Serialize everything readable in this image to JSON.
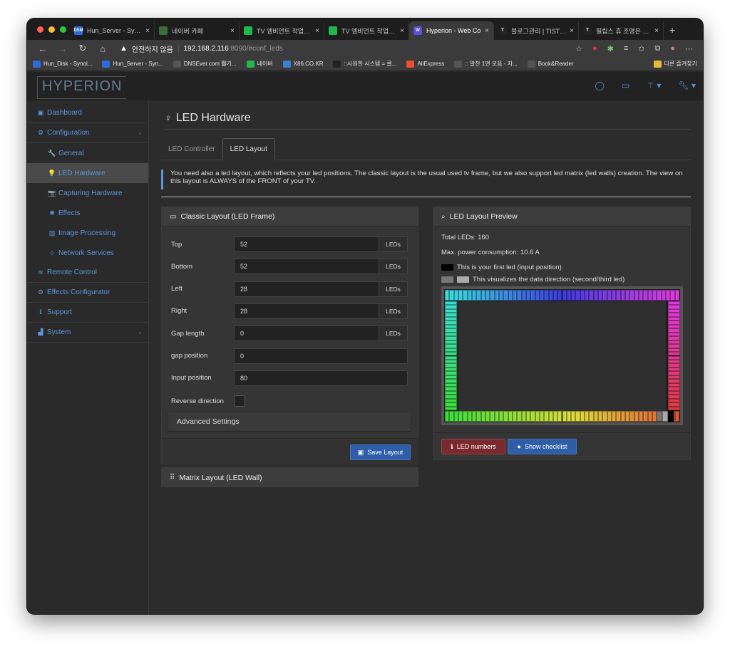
{
  "browser": {
    "tabs": [
      {
        "label": "Hun_Server - Synol",
        "icon_text": "DSM",
        "icon_color": "#2d6ad8",
        "active": false
      },
      {
        "label": "네이버 카페",
        "icon_text": "",
        "icon_color": "#3c6b3c",
        "active": false
      },
      {
        "label": "TV 엠비언트 작업기 1(",
        "icon_text": "",
        "icon_color": "#1fb84a",
        "active": false
      },
      {
        "label": "TV 엠비언트 작업기 1(",
        "icon_text": "",
        "icon_color": "#1fb84a",
        "active": false
      },
      {
        "label": "Hyperion - Web Co",
        "icon_text": "W",
        "icon_color": "#5a4fd8",
        "active": true
      },
      {
        "label": "블로그관리 | TISTOR",
        "icon_text": "T",
        "icon_color": "#222222",
        "active": false
      },
      {
        "label": "필립스 휴 조명은 가리",
        "icon_text": "T",
        "icon_color": "#222222",
        "active": false
      }
    ],
    "security_label": "안전하지 않음",
    "url_host": "192.168.2.116",
    "url_path": ":8090/#conf_leds",
    "bookmarks": [
      {
        "label": "Hun_Disk - Synol...",
        "color": "#2d6ad8"
      },
      {
        "label": "Hun_Server - Syn...",
        "color": "#2d6ad8"
      },
      {
        "label": "DNSEver.com 뭴기...",
        "color": "#555555"
      },
      {
        "label": "네이버",
        "color": "#1fb84a"
      },
      {
        "label": "X86.CO.KR",
        "color": "#3a7fd0"
      },
      {
        "label": "::시원한 시스템 = 쿨...",
        "color": "#222222"
      },
      {
        "label": "AliExpress",
        "color": "#e8502a"
      },
      {
        "label": ":: 알찬 1면 모음 - 자...",
        "color": "#555555"
      },
      {
        "label": "Book&Reader",
        "color": "#555555"
      }
    ],
    "other_bookmarks": "다른 즐겨찾기"
  },
  "app": {
    "logo": "HYPERION",
    "sidebar": [
      {
        "label": "Dashboard",
        "icon": "▣",
        "sub": false,
        "active": false,
        "caret": false,
        "name": "dashboard"
      },
      {
        "label": "Configuration",
        "icon": "⚙",
        "sub": false,
        "active": false,
        "caret": true,
        "name": "configuration"
      },
      {
        "label": "General",
        "icon": "🔧",
        "sub": true,
        "active": false,
        "caret": false,
        "name": "general"
      },
      {
        "label": "LED Hardware",
        "icon": "💡",
        "sub": true,
        "active": true,
        "caret": false,
        "name": "led-hardware"
      },
      {
        "label": "Capturing Hardware",
        "icon": "📷",
        "sub": true,
        "active": false,
        "caret": false,
        "name": "capturing-hardware"
      },
      {
        "label": "Effects",
        "icon": "✺",
        "sub": true,
        "active": false,
        "caret": false,
        "name": "effects"
      },
      {
        "label": "Image Processing",
        "icon": "▨",
        "sub": true,
        "active": false,
        "caret": false,
        "name": "image-processing"
      },
      {
        "label": "Network Services",
        "icon": "⊹",
        "sub": true,
        "active": false,
        "caret": false,
        "name": "network-services"
      },
      {
        "label": "Remote Control",
        "icon": "≋",
        "sub": false,
        "active": false,
        "caret": false,
        "name": "remote-control"
      },
      {
        "label": "Effects Configurator",
        "icon": "⚙",
        "sub": false,
        "active": false,
        "caret": false,
        "name": "effects-configurator"
      },
      {
        "label": "Support",
        "icon": "ℹ",
        "sub": false,
        "active": false,
        "caret": false,
        "name": "support"
      },
      {
        "label": "System",
        "icon": "▟",
        "sub": false,
        "active": false,
        "caret": true,
        "name": "system"
      }
    ],
    "page_title": "LED Hardware",
    "tabs": [
      "LED Controller",
      "LED Layout"
    ],
    "info": "You need also a led layout, which reflects your led positions. The classic layout is the usual used tv frame, but we also support led matrix (led walls) creation. The view on this layout is ALWAYS of the FRONT of your TV.",
    "classic": {
      "title": "Classic Layout (LED Frame)",
      "fields": [
        {
          "label": "Top",
          "value": "52",
          "addon": "LEDs"
        },
        {
          "label": "Bottom",
          "value": "52",
          "addon": "LEDs"
        },
        {
          "label": "Left",
          "value": "28",
          "addon": "LEDs"
        },
        {
          "label": "Right",
          "value": "28",
          "addon": "LEDs"
        },
        {
          "label": "Gap length",
          "value": "0",
          "addon": "LEDs"
        },
        {
          "label": "gap position",
          "value": "0",
          "addon": ""
        },
        {
          "label": "Input position",
          "value": "80",
          "addon": ""
        }
      ],
      "reverse_label": "Reverse direction",
      "advanced": "Advanced Settings",
      "save": "Save Layout"
    },
    "matrix_title": "Matrix Layout (LED Wall)",
    "preview": {
      "title": "LED Layout Preview",
      "total": "Total LEDs: 160",
      "power": "Max. power consumption: 10.6 A",
      "first_led": "This is your first led (input position)",
      "direction": "This visualizes the data direction (second/third led)",
      "led_numbers": "LED numbers",
      "checklist": "Show checklist"
    }
  }
}
